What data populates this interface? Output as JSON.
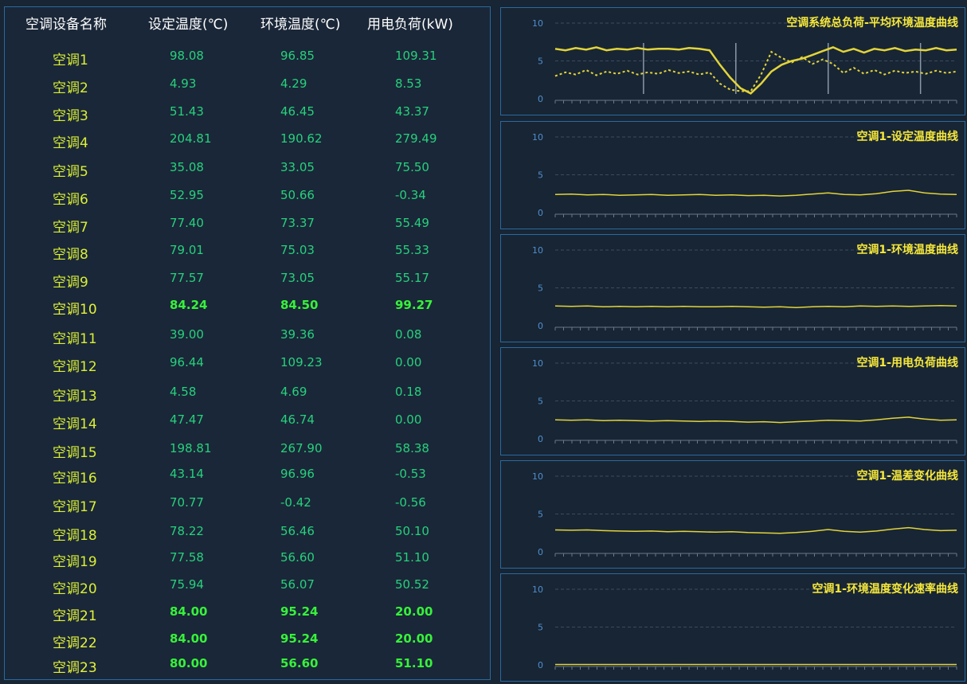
{
  "table": {
    "headers": [
      "空调设备名称",
      "设定温度(℃)",
      "环境温度(℃)",
      "用电负荷(kW)"
    ],
    "rows": [
      {
        "name": "空调1",
        "set": "98.08",
        "env": "96.85",
        "load": "109.31",
        "bright": false
      },
      {
        "name": "空调2",
        "set": "4.93",
        "env": "4.29",
        "load": "8.53",
        "bright": false
      },
      {
        "name": "空调3",
        "set": "51.43",
        "env": "46.45",
        "load": "43.37",
        "bright": false
      },
      {
        "name": "空调4",
        "set": "204.81",
        "env": "190.62",
        "load": "279.49",
        "bright": false
      },
      {
        "name": "空调5",
        "set": "35.08",
        "env": "33.05",
        "load": "75.50",
        "bright": false
      },
      {
        "name": "空调6",
        "set": "52.95",
        "env": "50.66",
        "load": "-0.34",
        "bright": false
      },
      {
        "name": "空调7",
        "set": "77.40",
        "env": "73.37",
        "load": "55.49",
        "bright": false
      },
      {
        "name": "空调8",
        "set": "79.01",
        "env": "75.03",
        "load": "55.33",
        "bright": false
      },
      {
        "name": "空调9",
        "set": "77.57",
        "env": "73.05",
        "load": "55.17",
        "bright": false
      },
      {
        "name": "空调10",
        "set": "84.24",
        "env": "84.50",
        "load": "99.27",
        "bright": true
      },
      {
        "name": "空调11",
        "set": "39.00",
        "env": "39.36",
        "load": "0.08",
        "bright": false
      },
      {
        "name": "空调12",
        "set": "96.44",
        "env": "109.23",
        "load": "0.00",
        "bright": false
      },
      {
        "name": "空调13",
        "set": "4.58",
        "env": "4.69",
        "load": "0.18",
        "bright": false
      },
      {
        "name": "空调14",
        "set": "47.47",
        "env": "46.74",
        "load": "0.00",
        "bright": false
      },
      {
        "name": "空调15",
        "set": "198.81",
        "env": "267.90",
        "load": "58.38",
        "bright": false
      },
      {
        "name": "空调16",
        "set": "43.14",
        "env": "96.96",
        "load": "-0.53",
        "bright": false
      },
      {
        "name": "空调17",
        "set": "70.77",
        "env": "-0.42",
        "load": "-0.56",
        "bright": false
      },
      {
        "name": "空调18",
        "set": "78.22",
        "env": "56.46",
        "load": "50.10",
        "bright": false
      },
      {
        "name": "空调19",
        "set": "77.58",
        "env": "56.60",
        "load": "51.10",
        "bright": false
      },
      {
        "name": "空调20",
        "set": "75.94",
        "env": "56.07",
        "load": "50.52",
        "bright": false
      },
      {
        "name": "空调21",
        "set": "84.00",
        "env": "95.24",
        "load": "20.00",
        "bright": true
      },
      {
        "name": "空调22",
        "set": "84.00",
        "env": "95.24",
        "load": "20.00",
        "bright": true
      },
      {
        "name": "空调23",
        "set": "80.00",
        "env": "56.60",
        "load": "51.10",
        "bright": true
      }
    ]
  },
  "colors": {
    "background": "#182534",
    "border": "#2a6a9e",
    "line": "#e2d43a",
    "title": "#f6e83a",
    "value": "#26d17d",
    "value_bright": "#36f23a",
    "name": "#d9ef34",
    "tick": "#4f8fd0",
    "grid": "#3b4b5e"
  },
  "chart_data": [
    {
      "type": "line",
      "title": "空调系统总负荷-平均环境温度曲线",
      "yticks": [
        "0",
        "5",
        "10"
      ],
      "ylim": [
        0,
        10
      ],
      "series": [
        {
          "values": [
            6.6,
            6.4,
            6.7,
            6.5,
            6.8,
            6.4,
            6.6,
            6.5,
            6.7,
            6.5,
            6.6,
            6.6,
            6.5,
            6.7,
            6.6,
            6.4,
            4.5,
            2.8,
            1.4,
            0.7,
            2.0,
            3.6,
            4.5,
            5.0,
            5.3,
            5.8,
            6.3,
            6.8,
            6.2,
            6.6,
            6.1,
            6.6,
            6.4,
            6.7,
            6.3,
            6.5,
            6.4,
            6.7,
            6.4,
            6.5
          ]
        },
        {
          "values": [
            3.0,
            3.5,
            3.2,
            3.8,
            3.1,
            3.6,
            3.3,
            3.7,
            3.2,
            3.5,
            3.3,
            3.8,
            3.4,
            3.6,
            3.2,
            3.5,
            2.0,
            1.2,
            1.0,
            1.0,
            3.2,
            6.2,
            5.4,
            4.8,
            5.5,
            4.6,
            5.2,
            4.6,
            3.4,
            4.1,
            3.3,
            3.8,
            3.2,
            3.7,
            3.4,
            3.6,
            3.3,
            3.7,
            3.4,
            3.6
          ]
        }
      ]
    },
    {
      "type": "line",
      "title": "空调1-设定温度曲线",
      "yticks": [
        "0",
        "5",
        "10"
      ],
      "ylim": [
        0,
        10
      ],
      "series": [
        {
          "values": [
            2.4,
            2.45,
            2.35,
            2.4,
            2.3,
            2.35,
            2.4,
            2.3,
            2.35,
            2.4,
            2.3,
            2.35,
            2.25,
            2.3,
            2.2,
            2.3,
            2.45,
            2.6,
            2.4,
            2.35,
            2.5,
            2.8,
            2.95,
            2.6,
            2.45,
            2.4
          ]
        }
      ]
    },
    {
      "type": "line",
      "title": "空调1-环境温度曲线",
      "yticks": [
        "0",
        "5",
        "10"
      ],
      "ylim": [
        0,
        10
      ],
      "series": [
        {
          "values": [
            2.6,
            2.55,
            2.6,
            2.5,
            2.55,
            2.5,
            2.55,
            2.5,
            2.55,
            2.5,
            2.5,
            2.55,
            2.5,
            2.45,
            2.5,
            2.4,
            2.5,
            2.55,
            2.5,
            2.6,
            2.55,
            2.6,
            2.55,
            2.6,
            2.65,
            2.6
          ]
        }
      ]
    },
    {
      "type": "line",
      "title": "空调1-用电负荷曲线",
      "yticks": [
        "0",
        "5",
        "10"
      ],
      "ylim": [
        0,
        10
      ],
      "series": [
        {
          "values": [
            2.5,
            2.45,
            2.5,
            2.4,
            2.45,
            2.4,
            2.35,
            2.4,
            2.35,
            2.3,
            2.35,
            2.3,
            2.2,
            2.25,
            2.15,
            2.25,
            2.35,
            2.45,
            2.4,
            2.35,
            2.5,
            2.7,
            2.85,
            2.6,
            2.45,
            2.5
          ]
        }
      ]
    },
    {
      "type": "line",
      "title": "空调1-温差变化曲线",
      "yticks": [
        "0",
        "5",
        "10"
      ],
      "ylim": [
        0,
        10
      ],
      "series": [
        {
          "values": [
            2.9,
            2.85,
            2.9,
            2.8,
            2.75,
            2.7,
            2.75,
            2.65,
            2.7,
            2.65,
            2.6,
            2.65,
            2.55,
            2.5,
            2.45,
            2.55,
            2.7,
            2.95,
            2.7,
            2.6,
            2.75,
            3.0,
            3.2,
            2.95,
            2.8,
            2.85
          ]
        }
      ]
    },
    {
      "type": "line",
      "title": "空调1-环境温度变化速率曲线",
      "yticks": [
        "0",
        "5",
        "10"
      ],
      "ylim": [
        0,
        10
      ],
      "series": [
        {
          "values": [
            0.05,
            0.05,
            0.05,
            0.05,
            0.05,
            0.05,
            0.05,
            0.05,
            0.05,
            0.05,
            0.05,
            0.05,
            0.05,
            0.05,
            0.05,
            0.05,
            0.05,
            0.05,
            0.05,
            0.05,
            0.05,
            0.05,
            0.05,
            0.05,
            0.05,
            0.05
          ]
        }
      ]
    }
  ]
}
